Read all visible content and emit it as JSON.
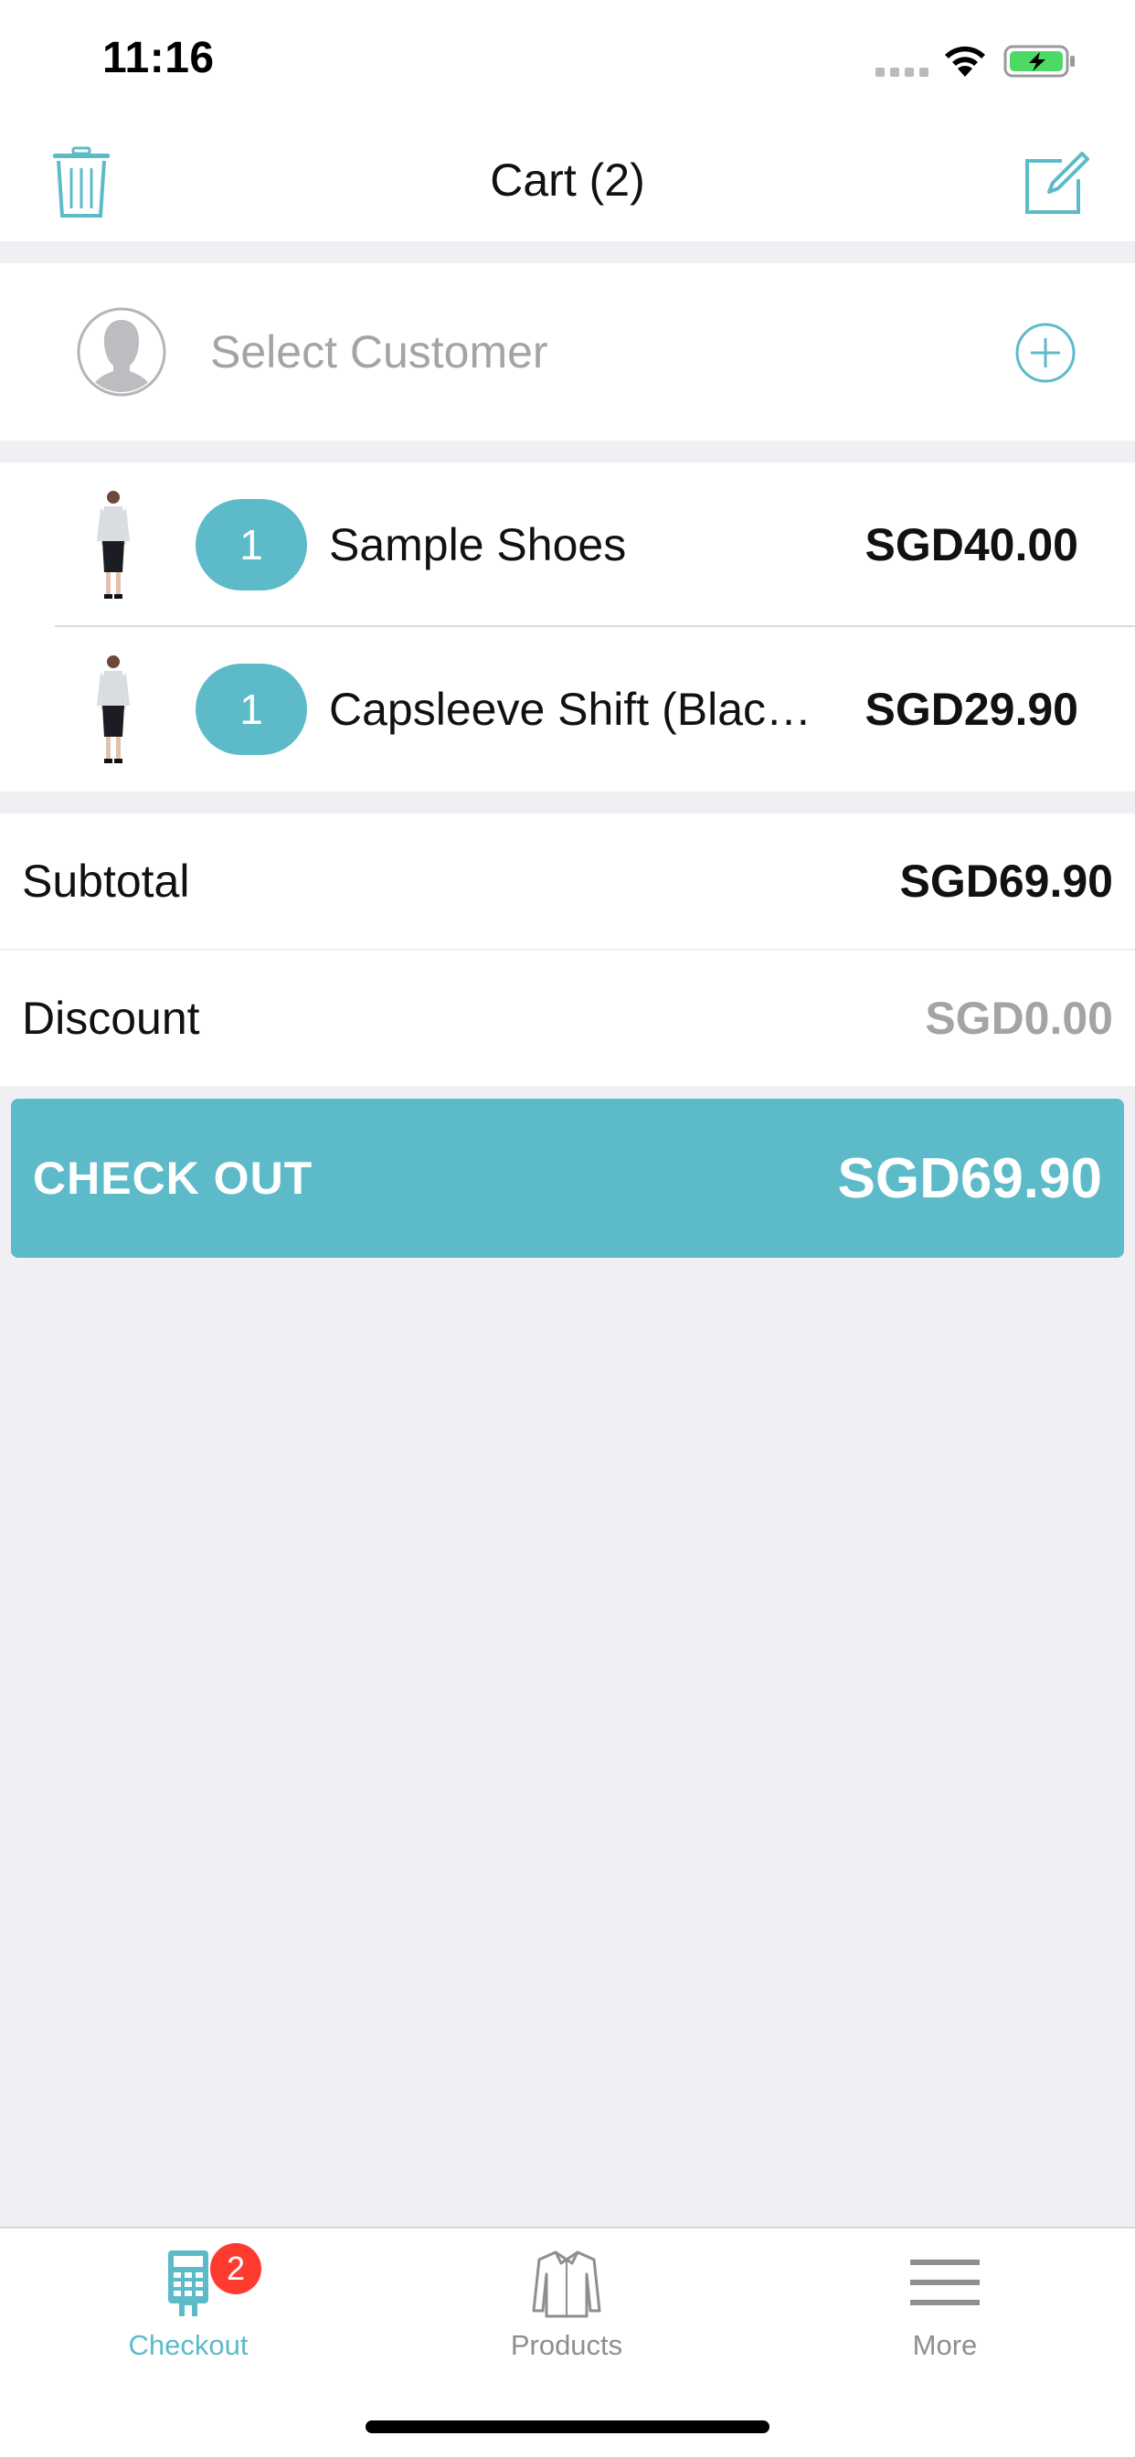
{
  "status_bar": {
    "time": "11:16"
  },
  "nav": {
    "title": "Cart (2)",
    "left_icon": "trash-icon",
    "right_icon": "compose-icon"
  },
  "customer": {
    "placeholder": "Select Customer",
    "avatar_icon": "user-avatar-icon",
    "add_icon": "add-circle-icon"
  },
  "cart": {
    "items": [
      {
        "quantity": "1",
        "name": "Sample Shoes",
        "price": "SGD40.00"
      },
      {
        "quantity": "1",
        "name": "Capsleeve Shift (Blac…",
        "price": "SGD29.90"
      }
    ]
  },
  "summary": {
    "subtotal_label": "Subtotal",
    "subtotal_value": "SGD69.90",
    "discount_label": "Discount",
    "discount_value": "SGD0.00"
  },
  "checkout": {
    "label": "CHECK OUT",
    "total": "SGD69.90"
  },
  "tabs": [
    {
      "label": "Checkout",
      "icon": "calculator-icon",
      "badge": "2",
      "active": true
    },
    {
      "label": "Products",
      "icon": "shirt-icon",
      "active": false
    },
    {
      "label": "More",
      "icon": "menu-icon",
      "active": false
    }
  ],
  "colors": {
    "accent": "#5dbbc9",
    "badge": "#ff3b30",
    "background": "#efeff4",
    "muted_text": "#a4a4a8"
  }
}
